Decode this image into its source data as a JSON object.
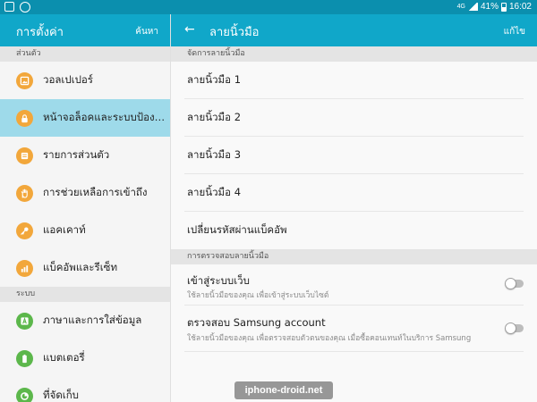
{
  "status_bar": {
    "network": "4G",
    "battery": "41%",
    "time": "16:02",
    "icons": [
      "image-notification-icon",
      "app-notification-icon",
      "signal-icon",
      "battery-icon"
    ]
  },
  "left_panel": {
    "title": "การตั้งค่า",
    "search_label": "ค้นหา",
    "sections": [
      {
        "label": "ส่วนตัว",
        "items": [
          {
            "label": "วอลเปเปอร์",
            "icon": "wallpaper-icon",
            "active": false
          },
          {
            "label": "หน้าจอล็อคและระบบป้องกั...",
            "icon": "lock-icon",
            "active": true
          },
          {
            "label": "รายการส่วนตัว",
            "icon": "private-icon",
            "active": false
          },
          {
            "label": "การช่วยเหลือการเข้าถึง",
            "icon": "accessibility-icon",
            "active": false
          },
          {
            "label": "แอคเคาท์",
            "icon": "key-icon",
            "active": false
          },
          {
            "label": "แบ็คอัพและรีเซ็ท",
            "icon": "backup-icon",
            "active": false
          }
        ]
      },
      {
        "label": "ระบบ",
        "items": [
          {
            "label": "ภาษาและการใส่ข้อมูล",
            "icon": "language-icon",
            "active": false
          },
          {
            "label": "แบตเตอรี่",
            "icon": "battery-icon",
            "active": false
          },
          {
            "label": "ที่จัดเก็บ",
            "icon": "storage-icon",
            "active": false
          }
        ]
      }
    ]
  },
  "right_panel": {
    "back_icon": "back-arrow-icon",
    "title": "ลายนิ้วมือ",
    "edit_label": "แก้ไข",
    "manage_section": {
      "label": "จัดการลายนิ้วมือ",
      "items": [
        "ลายนิ้วมือ 1",
        "ลายนิ้วมือ 2",
        "ลายนิ้วมือ 3",
        "ลายนิ้วมือ 4",
        "เปลี่ยนรหัสผ่านแบ็คอัพ"
      ]
    },
    "verify_section": {
      "label": "การตรวจสอบลายนิ้วมือ",
      "items": [
        {
          "title": "เข้าสู่ระบบเว็บ",
          "subtitle": "ใช้ลายนิ้วมือของคุณ เพื่อเข้าสู่ระบบเว็บไซต์",
          "enabled": false
        },
        {
          "title": "ตรวจสอบ Samsung account",
          "subtitle": "ใช้ลายนิ้วมือของคุณ เพื่อตรวจสอบตัวตนของคุณ เมื่อซื้อคอนเทนท์ในบริการ Samsung",
          "enabled": false
        }
      ]
    }
  },
  "watermark": "iphone-droid.net",
  "colors": {
    "status_bar": "#0b8fae",
    "header": "#10a7c9",
    "active_item": "#9edaea",
    "orange_icon": "#f2a73b",
    "green_icon": "#5cb74b"
  }
}
